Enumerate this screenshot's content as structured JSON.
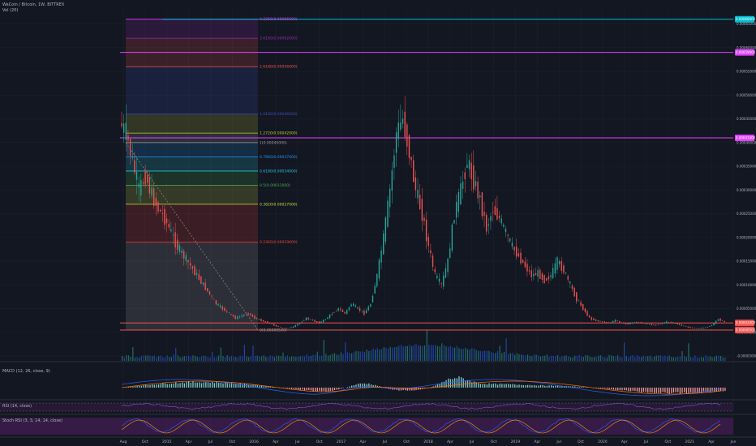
{
  "header": {
    "symbol": "WaCoin / Bitcoin, 1W, BITTREX",
    "vol_label": "Vol (20)"
  },
  "indicators": {
    "macd": "MACD (12, 26, close, 9)",
    "rsi": "RSI (14, close)",
    "stoch": "Stoch RSI (3, 3, 14, 14, close)"
  },
  "colors": {
    "background": "#131722",
    "up": "#26a69a",
    "down": "#ef5350",
    "cyan": "#00bcd4",
    "magenta": "#e040fb",
    "purple": "#9c27b0",
    "grid": "#1e222d"
  },
  "chart_data": {
    "type": "candlestick",
    "x_tick_labels": [
      "Aug",
      "Oct",
      "2015",
      "Apr",
      "Jul",
      "Oct",
      "2016",
      "Apr",
      "Jul",
      "Oct",
      "2017",
      "Apr",
      "Jul",
      "Oct",
      "2018",
      "Apr",
      "Jul",
      "Oct",
      "2019",
      "Apr",
      "Jul",
      "Oct",
      "2020",
      "Apr",
      "Jul",
      "Oct",
      "2021",
      "Apr",
      "Jun"
    ],
    "price_axis_labels": [
      "0.00065000",
      "0.00060000",
      "0.00055000",
      "0.00050000",
      "0.00045000",
      "0.00040000",
      "0.00035000",
      "0.00030000",
      "0.00025000",
      "0.00020000",
      "0.00015000",
      "0.00010000",
      "0.00005000",
      "0.00000000",
      "-0.00005000"
    ],
    "price_axis_values": [
      0.00065,
      0.0006,
      0.00055,
      0.0005,
      0.00045,
      0.0004,
      0.00035,
      0.0003,
      0.00025,
      0.0002,
      0.00015,
      0.0001,
      5e-05,
      0,
      -5e-05
    ],
    "y_range": [
      -6e-05,
      0.00068
    ],
    "price_tags": [
      {
        "text": "0.00066000",
        "color": "#00bcd4",
        "value": 0.00066
      },
      {
        "text": "0.00059000",
        "color": "#e040fb",
        "value": 0.00059
      },
      {
        "text": "0.00041000",
        "color": "#e040fb",
        "value": 0.00041
      },
      {
        "text": "0.00002000",
        "color": "#ef5350",
        "value": 2e-05
      },
      {
        "text": "0.00000500",
        "color": "#ef5350",
        "value": 5e-06
      }
    ],
    "horizontal_lines": [
      {
        "value": 0.00066,
        "color": "#00bcd4"
      },
      {
        "value": 0.00059,
        "color": "#e040fb"
      },
      {
        "value": 0.00041,
        "color": "#e040fb"
      },
      {
        "value": 2e-05,
        "color": "#ef5350"
      },
      {
        "value": 5e-06,
        "color": "#ef5350"
      }
    ],
    "fib_levels": [
      {
        "label": "4.2360(0.00066000)",
        "value": 0.00066,
        "color": "#e040fb"
      },
      {
        "label": "3.6180(0.00062000)",
        "value": 0.00062,
        "color": "#9c27b0"
      },
      {
        "label": "2.6180(0.00056000)",
        "value": 0.00056,
        "color": "#ef5350"
      },
      {
        "label": "1.6180(0.00046000)",
        "value": 0.00046,
        "color": "#3f51b5"
      },
      {
        "label": "1.2720(0.00042000)",
        "value": 0.00042,
        "color": "#c0ca33"
      },
      {
        "label": "1(0.00040000)",
        "value": 0.0004,
        "color": "#9e9e9e"
      },
      {
        "label": "0.7860(0.00037000)",
        "value": 0.00037,
        "color": "#2196f3"
      },
      {
        "label": "0.6180(0.00034000)",
        "value": 0.00034,
        "color": "#26c6da"
      },
      {
        "label": "0.5(0.00031000)",
        "value": 0.00031,
        "color": "#4caf50"
      },
      {
        "label": "0.3820(0.00027000)",
        "value": 0.00027,
        "color": "#cddc39"
      },
      {
        "label": "0.2360(0.00019000)",
        "value": 0.00019,
        "color": "#f44336"
      },
      {
        "label": "0(0.00000500)",
        "value": 5e-06,
        "color": "#9e9e9e"
      }
    ],
    "close_series": [
      0.00042,
      0.00036,
      0.0003,
      0.00033,
      0.00029,
      0.00026,
      0.00024,
      0.00021,
      0.00018,
      0.00016,
      0.00014,
      0.00012,
      0.0001,
      8e-05,
      6e-05,
      5e-05,
      4e-05,
      3e-05,
      3.5e-05,
      4e-05,
      3e-05,
      2.5e-05,
      2e-05,
      1.5e-05,
      1e-05,
      8e-06,
      1.2e-05,
      2e-05,
      3e-05,
      2.5e-05,
      2e-05,
      2.8e-05,
      4e-05,
      5e-05,
      4e-05,
      6e-05,
      5e-05,
      4e-05,
      6e-05,
      0.00012,
      0.0002,
      0.0003,
      0.00042,
      0.00045,
      0.00038,
      0.0003,
      0.00025,
      0.00018,
      0.00012,
      0.0001,
      0.00015,
      0.00025,
      0.0003,
      0.00036,
      0.00032,
      0.00028,
      0.00022,
      0.00026,
      0.00024,
      0.00021,
      0.00018,
      0.00016,
      0.00014,
      0.00012,
      0.000125,
      0.00011,
      0.00012,
      0.00015,
      0.00013,
      0.0001,
      7e-05,
      5e-05,
      3e-05,
      2.5e-05,
      2.2e-05,
      2e-05,
      2.5e-05,
      2e-05,
      1.8e-05,
      2.2e-05,
      2e-05,
      1.8e-05,
      1.5e-05,
      1.8e-05,
      2.2e-05,
      2e-05,
      1.6e-05,
      1.2e-05,
      9e-06,
      8e-06,
      1e-05,
      1.5e-05,
      2.8e-05,
      2.2e-05
    ]
  }
}
